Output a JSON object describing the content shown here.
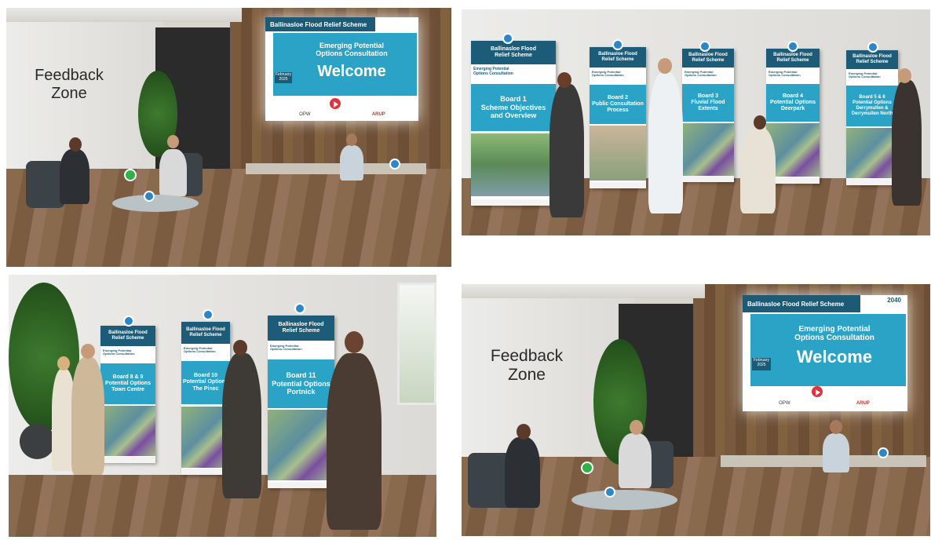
{
  "panels": {
    "top_left": {
      "wall_sign": [
        "Feedback",
        "Zone"
      ],
      "screen": {
        "header": "Ballinasloe Flood Relief Scheme",
        "subtitle": [
          "Emerging Potential",
          "Options Consultation"
        ],
        "headline": "Welcome",
        "date": [
          "February",
          "2025"
        ],
        "logo_arup": "ARUP",
        "logo_opw": "OPW"
      }
    },
    "top_right": {
      "banners": [
        {
          "header": [
            "Ballinasloe Flood",
            "Relief Scheme"
          ],
          "sub": [
            "Emerging Potential",
            "Options Consultation"
          ],
          "title": [
            "Board 1",
            "Scheme Objectives",
            "and Overview"
          ]
        },
        {
          "header": [
            "Ballinasloe Flood",
            "Relief Scheme"
          ],
          "sub": [
            "Emerging Potential",
            "Options Consultation"
          ],
          "title": [
            "Board 2",
            "Public Consultation",
            "Process"
          ]
        },
        {
          "header": [
            "Ballinasloe Flood",
            "Relief Scheme"
          ],
          "sub": [
            "Emerging Potential",
            "Options Consultation"
          ],
          "title": [
            "Board 3",
            "Fluvial Flood",
            "Extents"
          ]
        },
        {
          "header": [
            "Ballinasloe Flood",
            "Relief Scheme"
          ],
          "sub": [
            "Emerging Potential",
            "Options Consultation"
          ],
          "title": [
            "Board 4",
            "Potential Options",
            "Deerpark"
          ]
        },
        {
          "header": [
            "Ballinasloe Flood",
            "Relief Scheme"
          ],
          "sub": [
            "Emerging Potential",
            "Options Consultation"
          ],
          "title": [
            "Board 5 & 6",
            "Potential Options",
            "Derrymullen &",
            "Derrymullen North"
          ]
        }
      ]
    },
    "bottom_left": {
      "banners": [
        {
          "header": [
            "Ballinasloe Flood",
            "Relief Scheme"
          ],
          "sub": [
            "Emerging Potential",
            "Options Consultation"
          ],
          "title": [
            "Board 8 & 9",
            "Potential Options",
            "Town Centre"
          ]
        },
        {
          "header": [
            "Ballinasloe Flood",
            "Relief Scheme"
          ],
          "sub": [
            "Emerging Potential",
            "Options Consultation"
          ],
          "title": [
            "Board 10",
            "Potential Options",
            "The Pinec"
          ]
        },
        {
          "header": [
            "Ballinasloe Flood",
            "Relief Scheme"
          ],
          "sub": [
            "Emerging Potential",
            "Options Consultation"
          ],
          "title": [
            "Board 11",
            "Potential Options",
            "Portnick"
          ]
        }
      ]
    },
    "bottom_right": {
      "wall_sign": [
        "Feedback",
        "Zone"
      ],
      "screen": {
        "header": "Ballinasloe Flood Relief Scheme",
        "subtitle": [
          "Emerging Potential",
          "Options Consultation"
        ],
        "headline": "Welcome",
        "date": [
          "February",
          "2025"
        ],
        "logo_arup": "ARUP",
        "logo_opw": "OPW",
        "logo_2040": "2040"
      }
    }
  },
  "colors": {
    "banner_header": "#1d5c78",
    "banner_mid": "#2aa3c6",
    "hotspot_info": "#2b87c8",
    "hotspot_chat": "#2fb24a",
    "play_button": "#e0343c"
  },
  "icons": [
    "info-hotspot-icon",
    "chat-hotspot-icon",
    "play-icon"
  ]
}
